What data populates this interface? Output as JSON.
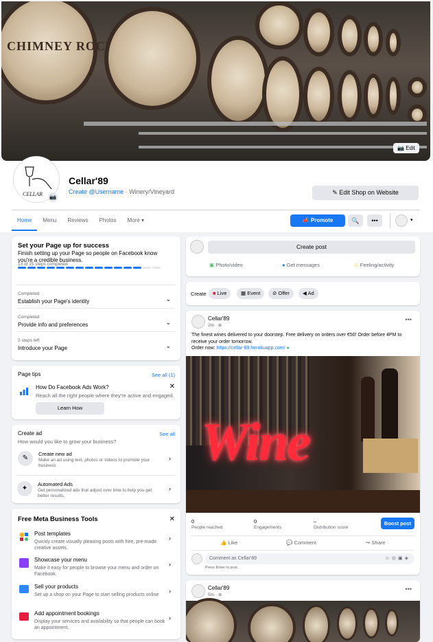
{
  "cover": {
    "edit_label": "Edit",
    "barrel_text": "CHIMNEY ROCK"
  },
  "profile": {
    "name": "Cellar'89",
    "username_link": "Create @Username",
    "category": " · Winery/Vineyard",
    "logo_text": "CELLAR",
    "edit_shop_label": "Edit Shop on Website"
  },
  "tabs": [
    "Home",
    "Menu",
    "Reviews",
    "Photos",
    "More ▾"
  ],
  "actions": {
    "promote": "Promote",
    "search_icon": "🔍",
    "more_icon": "•••",
    "dropdown": "▾"
  },
  "setup": {
    "title": "Set your Page up for success",
    "subtitle": "Finish setting up your Page so people on Facebook know you're a credible business.",
    "progress_text": "13 of 15 steps completed",
    "progress_done": 13,
    "progress_total": 15,
    "steps": [
      {
        "status": "Completed",
        "label": "Establish your Page's identity"
      },
      {
        "status": "Completed",
        "label": "Provide info and preferences"
      },
      {
        "status": "2 steps left",
        "label": "Introduce your Page"
      }
    ]
  },
  "page_tips": {
    "title": "Page tips",
    "see_all": "See all (1)",
    "tip_title": "How Do Facebook Ads Work?",
    "tip_desc": "Reach all the right people where they're active and engaged.",
    "button": "Learn How"
  },
  "create_ad": {
    "title": "Create ad",
    "see_all": "See all",
    "subtitle": "How would you like to grow your business?",
    "items": [
      {
        "title": "Create new ad",
        "desc": "Make an ad using text, photos or videos to promote your business"
      },
      {
        "title": "Automated Ads",
        "desc": "Get personalized ads that adjust over time to help you get better results."
      }
    ]
  },
  "tools": {
    "title": "Free Meta Business Tools",
    "items": [
      {
        "title": "Post templates",
        "desc": "Quickly create visually pleasing posts with free, pre-made creative assets."
      },
      {
        "title": "Showcase your menu",
        "desc": "Make it easy for people to browse your menu and order on Facebook."
      },
      {
        "title": "Sell your products",
        "desc": "Set up a shop on your Page to start selling products online"
      },
      {
        "title": "Add appointment bookings",
        "desc": "Display your services and availability so that people can book an appointment."
      }
    ]
  },
  "composer": {
    "create_post": "Create post",
    "photo": "Photo/video",
    "messages": "Get messages",
    "feeling": "Feeling/activity"
  },
  "create_bar": {
    "label": "Create",
    "items": [
      "Live",
      "Event",
      "Offer",
      "Ad"
    ]
  },
  "post1": {
    "author": "Cellar'89",
    "time": "2m · ",
    "text": "The finest wines delivered to your doorstep. Free delivery on orders over €50!  Order before 4PM to receive your order tomorrow.",
    "order_prefix": "Order now: ",
    "order_link": "https://cellar-89.herokuapp.com/",
    "image_word": "Wine",
    "stats": [
      {
        "value": "0",
        "label": "People reached"
      },
      {
        "value": "0",
        "label": "Engagements"
      },
      {
        "value": "–",
        "label": "Distribution score"
      }
    ],
    "boost": "Boost post",
    "like": "Like",
    "comment": "Comment",
    "share": "Share",
    "comment_placeholder": "Comment as Cellar'89",
    "enter_hint": "Press Enter to post."
  },
  "post2": {
    "author": "Cellar'89",
    "time": "5m · "
  },
  "colors": {
    "accent": "#1877f2",
    "bg": "#f0f2f5",
    "wine_neon": "#ff2a3a"
  }
}
